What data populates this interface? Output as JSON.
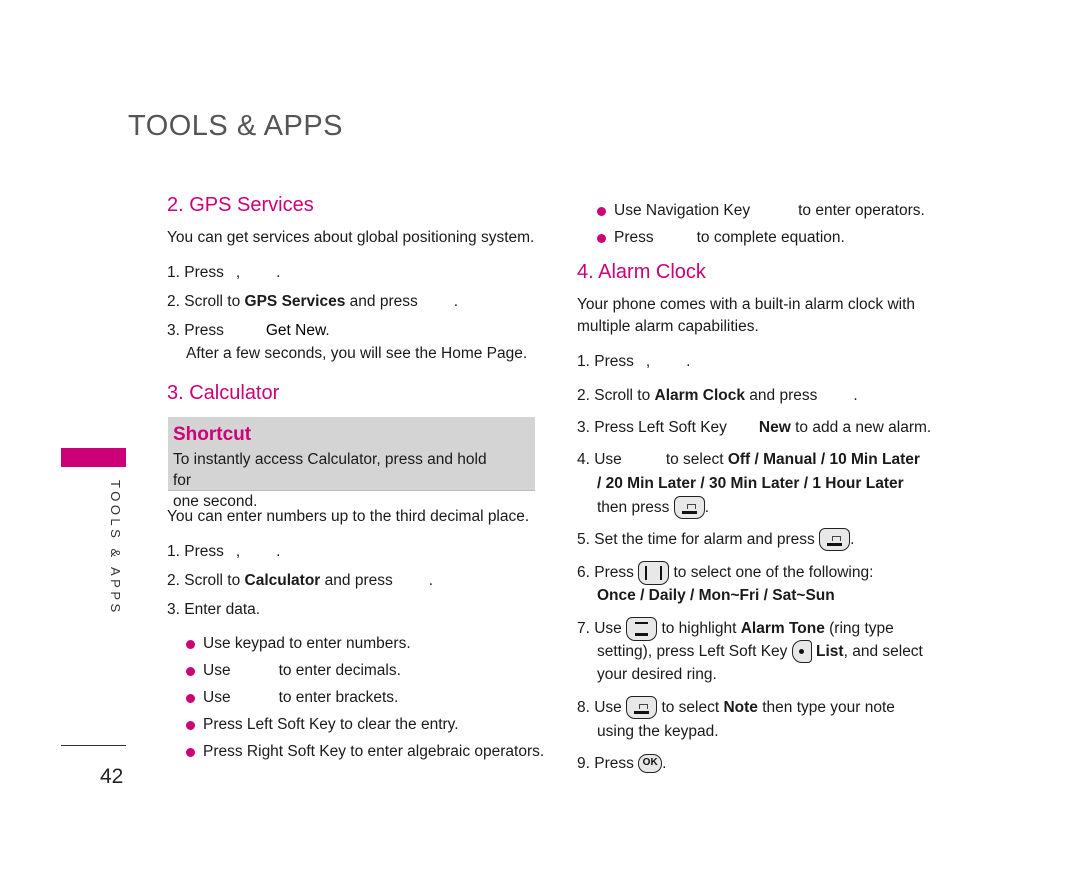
{
  "chapter_title": "TOOLS & APPS",
  "side_label": "TOOLS & APPS",
  "page_number": "42",
  "accent_color": "#cc0077",
  "gps": {
    "heading": "2. GPS Services",
    "intro": "You can get services about global positioning system.",
    "step1": "1. Press",
    "step1_sep1": ",",
    "step1_end": ".",
    "step2_pre": "2. Scroll to ",
    "step2_bold": "GPS Services",
    "step2_post": " and press",
    "step2_end": ".",
    "step3_pre": "3. Press",
    "step3_bold": "Get New",
    "step3_end": ".",
    "step3_note": "After a few seconds, you will see the Home Page."
  },
  "calculator": {
    "heading": "3. Calculator",
    "shortcut_title": "Shortcut",
    "shortcut_text_a": "To instantly access Calculator, press and hold",
    "shortcut_text_b": "for",
    "shortcut_text_c": "one second.",
    "intro": "You can enter numbers up to the third decimal place.",
    "step1": "1. Press",
    "step1_sep1": ",",
    "step1_end": ".",
    "step2_pre": "2. Scroll to ",
    "step2_bold": "Calculator",
    "step2_post": " and press",
    "step2_end": ".",
    "step3": "3. Enter data.",
    "bullets": [
      {
        "a": "Use keypad to enter numbers.",
        "b": ""
      },
      {
        "a": "Use",
        "b": "to enter decimals."
      },
      {
        "a": "Use",
        "b": "to enter brackets."
      },
      {
        "a": "Press Left Soft Key to clear the entry.",
        "b": ""
      },
      {
        "a": "Press Right Soft Key to enter algebraic operators.",
        "b": ""
      },
      {
        "a": "Use Navigation Key",
        "b": "to enter operators."
      },
      {
        "a": "Press",
        "b": "to complete equation."
      }
    ]
  },
  "alarm": {
    "heading": "4. Alarm Clock",
    "intro_line1": "Your phone comes with a built-in alarm clock with",
    "intro_line2": "multiple alarm capabilities.",
    "step1": "1. Press",
    "step1_sep1": ",",
    "step1_end": ".",
    "step2_pre": "2. Scroll to ",
    "step2_bold": "Alarm Clock",
    "step2_post": " and press",
    "step2_end": ".",
    "step3_pre": "3. Press Left Soft Key",
    "step3_bold": "New",
    "step3_post": " to add a new alarm.",
    "step4_pre": "4. Use",
    "step4_mid": "to select ",
    "step4_opts_line1": "Off / Manual / 10 Min Later",
    "step4_opts_line2": "/ 20 Min Later / 30 Min Later / 1 Hour Later",
    "step4_then": "then press",
    "step4_end": ".",
    "step5_pre": "5. Set the time for alarm and press",
    "step5_end": ".",
    "step6_pre": "6. Press",
    "step6_post": "to select one of the following:",
    "step6_opts": "Once / Daily / Mon~Fri / Sat~Sun",
    "step7_pre": "7. Use",
    "step7_mid": "to highlight ",
    "step7_bold": "Alarm Tone",
    "step7_post": " (ring type",
    "step7_line2_pre": "setting), press Left Soft Key",
    "step7_line2_bold": "List",
    "step7_line2_post": ", and select",
    "step7_line3": "your desired ring.",
    "step8_pre": "8. Use",
    "step8_mid": "to select ",
    "step8_bold": "Note",
    "step8_post": " then type your note",
    "step8_line2": "using the keypad.",
    "step9_pre": "9. Press",
    "step9_key": "OK",
    "step9_end": "."
  }
}
